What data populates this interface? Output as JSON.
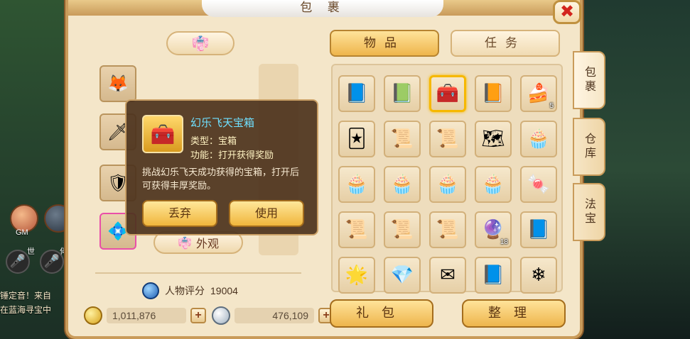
{
  "window": {
    "title": "包 裹"
  },
  "close_icon": "✖",
  "background": {
    "chat_lines": [
      "锤定音！来自",
      "在蓝海寻宝中"
    ],
    "side_labels": [
      "GM",
      "世",
      "何"
    ]
  },
  "left": {
    "costume_icon": "👘",
    "equip_slots": [
      {
        "name": "pet-equip-slot",
        "glyph": "🦊"
      },
      {
        "name": "necklace-equip-slot",
        "glyph": "📿"
      },
      {
        "name": "weapon-equip-slot",
        "glyph": "🗡"
      },
      {
        "name": "armor-equip-slot",
        "glyph": "🛡"
      },
      {
        "name": "accessory-equip-slot",
        "glyph": "💠"
      }
    ],
    "appearance_label": "外观",
    "score_label": "人物评分",
    "score_value": "19004",
    "gold_amount": "1,011,876",
    "silver_amount": "476,109",
    "plus_label": "+"
  },
  "tooltip": {
    "item_name": "幻乐飞天宝箱",
    "type_line": "类型：宝箱",
    "function_line": "功能：打开获得奖励",
    "description": "挑战幻乐飞天成功获得的宝箱，打开后可获得丰厚奖励。",
    "discard_label": "丢弃",
    "use_label": "使用",
    "icon_glyph": "🧰"
  },
  "tabs": {
    "items": "物品",
    "tasks": "任务"
  },
  "side_tabs": [
    "包裹",
    "仓库",
    "法宝"
  ],
  "inventory": [
    {
      "name": "blue-book",
      "glyph": "📘",
      "count": ""
    },
    {
      "name": "map-book",
      "glyph": "📗",
      "count": ""
    },
    {
      "name": "treasure-chest",
      "glyph": "🧰",
      "count": "",
      "selected": true
    },
    {
      "name": "skill-book",
      "glyph": "📙",
      "count": ""
    },
    {
      "name": "cake-slice",
      "glyph": "🍰",
      "count": "5"
    },
    {
      "name": "cards",
      "glyph": "🃏",
      "count": ""
    },
    {
      "name": "red-scroll-1",
      "glyph": "📜",
      "count": ""
    },
    {
      "name": "red-scroll-2",
      "glyph": "📜",
      "count": ""
    },
    {
      "name": "map-parchment",
      "glyph": "🗺",
      "count": ""
    },
    {
      "name": "cupcake-1",
      "glyph": "🧁",
      "count": ""
    },
    {
      "name": "cupcake-2",
      "glyph": "🧁",
      "count": ""
    },
    {
      "name": "cupcake-3",
      "glyph": "🧁",
      "count": ""
    },
    {
      "name": "cupcake-4",
      "glyph": "🧁",
      "count": ""
    },
    {
      "name": "cupcake-5",
      "glyph": "🧁",
      "count": ""
    },
    {
      "name": "green-candy",
      "glyph": "🍬",
      "count": ""
    },
    {
      "name": "scroll-1",
      "glyph": "📜",
      "count": ""
    },
    {
      "name": "scroll-2",
      "glyph": "📜",
      "count": ""
    },
    {
      "name": "scroll-3",
      "glyph": "📜",
      "count": ""
    },
    {
      "name": "magic-orb",
      "glyph": "🔮",
      "count": "18"
    },
    {
      "name": "blue-tome",
      "glyph": "📘",
      "count": ""
    },
    {
      "name": "star-gem",
      "glyph": "🌟",
      "count": ""
    },
    {
      "name": "rock-gem",
      "glyph": "💎",
      "count": ""
    },
    {
      "name": "envelope",
      "glyph": "✉",
      "count": ""
    },
    {
      "name": "blue-book-2",
      "glyph": "📘",
      "count": ""
    },
    {
      "name": "ice-gem",
      "glyph": "❄",
      "count": ""
    }
  ],
  "bottom_buttons": {
    "gift": "礼包",
    "sort": "整理"
  }
}
